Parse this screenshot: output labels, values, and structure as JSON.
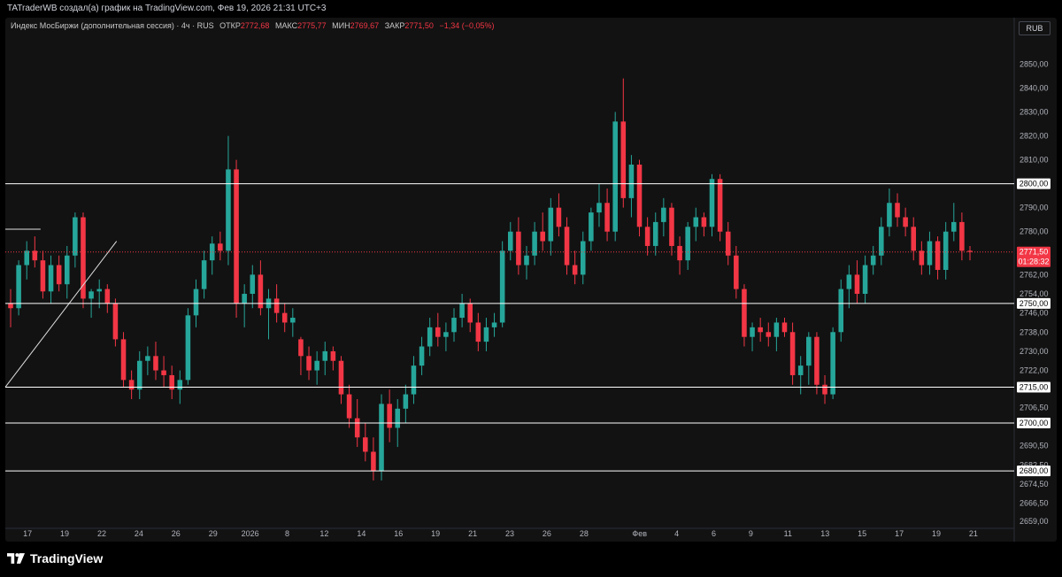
{
  "header": {
    "credit": "TATraderWB создал(а) график на TradingView.com, Фев 19, 2026 21:31 UTC+3"
  },
  "legend": {
    "symbol": "Индекс МосБиржи (дополнительная сессия) · 4ч · RUS",
    "open_label": "ОТКР",
    "open": "2772,68",
    "high_label": "МАКС",
    "high": "2775,77",
    "low_label": "МИН",
    "low": "2769,67",
    "close_label": "ЗАКР",
    "close": "2771,50",
    "change": "−1,34 (−0,05%)"
  },
  "currency_button": "RUB",
  "footer": {
    "brand": "TradingView"
  },
  "colors": {
    "up": "#26a69a",
    "down": "#f23645",
    "level_line": "#ffffff",
    "background": "#121212"
  },
  "chart_data": {
    "type": "candlestick",
    "timeframe": "4ч",
    "ylim": [
      2656,
      2862
    ],
    "y_ticks": [
      "2850,00",
      "2840,00",
      "2830,00",
      "2820,00",
      "2810,00",
      "2800,00",
      "2790,00",
      "2780,00",
      "2770,00",
      "2762,00",
      "2754,00",
      "2746,00",
      "2738,00",
      "2730,00",
      "2722,00",
      "2714,00",
      "2706,50",
      "2698,50",
      "2690,50",
      "2682,50",
      "2674,50",
      "2666,50",
      "2659,00"
    ],
    "y_tick_values": [
      2850,
      2840,
      2830,
      2820,
      2810,
      2800,
      2790,
      2780,
      2770,
      2762,
      2754,
      2746,
      2738,
      2730,
      2722,
      2714,
      2706.5,
      2698.5,
      2690.5,
      2682.5,
      2674.5,
      2666.5,
      2659
    ],
    "hidden_tick_labels": [
      "2770,00",
      "2714,00",
      "2698,50"
    ],
    "x_ticks": [
      {
        "label": "17",
        "x": 0.6
      },
      {
        "label": "19",
        "x": 1.6
      },
      {
        "label": "22",
        "x": 2.6
      },
      {
        "label": "24",
        "x": 3.6
      },
      {
        "label": "26",
        "x": 4.6
      },
      {
        "label": "29",
        "x": 5.6
      },
      {
        "label": "2026",
        "x": 6.6
      },
      {
        "label": "8",
        "x": 7.6
      },
      {
        "label": "12",
        "x": 8.6
      },
      {
        "label": "14",
        "x": 9.6
      },
      {
        "label": "16",
        "x": 10.6
      },
      {
        "label": "19",
        "x": 11.6
      },
      {
        "label": "21",
        "x": 12.6
      },
      {
        "label": "23",
        "x": 13.6
      },
      {
        "label": "26",
        "x": 14.6
      },
      {
        "label": "28",
        "x": 15.6
      },
      {
        "label": "Фев",
        "x": 17.1
      },
      {
        "label": "4",
        "x": 18.1
      },
      {
        "label": "6",
        "x": 19.1
      },
      {
        "label": "9",
        "x": 20.1
      },
      {
        "label": "11",
        "x": 21.1
      },
      {
        "label": "13",
        "x": 22.1
      },
      {
        "label": "15",
        "x": 23.1
      },
      {
        "label": "17",
        "x": 24.1
      },
      {
        "label": "19",
        "x": 25.1
      },
      {
        "label": "21",
        "x": 26.1
      }
    ],
    "x_range": [
      0,
      27.2
    ],
    "levels": [
      {
        "value": 2800.0,
        "label": "2800,00"
      },
      {
        "value": 2750.0,
        "label": "2750,00"
      },
      {
        "value": 2715.0,
        "label": "2715,00"
      },
      {
        "value": 2700.0,
        "label": "2700,00"
      },
      {
        "value": 2680.0,
        "label": "2680,00"
      }
    ],
    "short_level": {
      "value": 2781,
      "x_end": 0.95
    },
    "trendline": {
      "x1": 0,
      "y1": 2715,
      "x2": 3.0,
      "y2": 2776
    },
    "last_price": {
      "value": 2771.5,
      "label": "2771,50",
      "countdown": "01:28:32"
    },
    "candles_ohlc_hint": "approximate reading from the screenshot",
    "candles": [
      [
        2750,
        2756,
        2740,
        2748
      ],
      [
        2748,
        2768,
        2745,
        2766
      ],
      [
        2766,
        2776,
        2760,
        2772
      ],
      [
        2772,
        2778,
        2765,
        2768
      ],
      [
        2768,
        2772,
        2752,
        2755
      ],
      [
        2755,
        2770,
        2750,
        2766
      ],
      [
        2766,
        2770,
        2755,
        2758
      ],
      [
        2758,
        2774,
        2752,
        2770
      ],
      [
        2770,
        2788,
        2765,
        2786
      ],
      [
        2786,
        2788,
        2748,
        2752
      ],
      [
        2752,
        2756,
        2744,
        2755
      ],
      [
        2755,
        2760,
        2748,
        2756
      ],
      [
        2756,
        2758,
        2746,
        2750
      ],
      [
        2750,
        2752,
        2732,
        2735
      ],
      [
        2735,
        2738,
        2715,
        2718
      ],
      [
        2718,
        2722,
        2710,
        2714
      ],
      [
        2714,
        2730,
        2710,
        2726
      ],
      [
        2726,
        2732,
        2720,
        2728
      ],
      [
        2728,
        2734,
        2718,
        2722
      ],
      [
        2722,
        2728,
        2715,
        2720
      ],
      [
        2720,
        2724,
        2710,
        2714
      ],
      [
        2714,
        2722,
        2708,
        2718
      ],
      [
        2718,
        2748,
        2716,
        2745
      ],
      [
        2745,
        2760,
        2740,
        2756
      ],
      [
        2756,
        2772,
        2752,
        2768
      ],
      [
        2768,
        2778,
        2762,
        2775
      ],
      [
        2775,
        2780,
        2768,
        2772
      ],
      [
        2772,
        2820,
        2766,
        2806
      ],
      [
        2806,
        2810,
        2744,
        2750
      ],
      [
        2750,
        2758,
        2740,
        2754
      ],
      [
        2754,
        2766,
        2748,
        2762
      ],
      [
        2762,
        2768,
        2745,
        2748
      ],
      [
        2748,
        2756,
        2735,
        2752
      ],
      [
        2752,
        2758,
        2742,
        2746
      ],
      [
        2746,
        2750,
        2738,
        2742
      ],
      [
        2742,
        2748,
        2736,
        2744
      ],
      [
        2735,
        2736,
        2720,
        2728
      ],
      [
        2728,
        2732,
        2718,
        2722
      ],
      [
        2722,
        2730,
        2716,
        2726
      ],
      [
        2726,
        2734,
        2720,
        2730
      ],
      [
        2730,
        2732,
        2722,
        2726
      ],
      [
        2726,
        2728,
        2708,
        2712
      ],
      [
        2712,
        2716,
        2698,
        2702
      ],
      [
        2702,
        2710,
        2690,
        2694
      ],
      [
        2694,
        2700,
        2684,
        2688
      ],
      [
        2688,
        2694,
        2676,
        2680
      ],
      [
        2680,
        2712,
        2676,
        2708
      ],
      [
        2708,
        2714,
        2692,
        2698
      ],
      [
        2698,
        2710,
        2690,
        2706
      ],
      [
        2706,
        2716,
        2700,
        2712
      ],
      [
        2712,
        2728,
        2708,
        2724
      ],
      [
        2724,
        2736,
        2720,
        2732
      ],
      [
        2732,
        2744,
        2728,
        2740
      ],
      [
        2740,
        2746,
        2732,
        2736
      ],
      [
        2736,
        2742,
        2730,
        2738
      ],
      [
        2738,
        2748,
        2734,
        2744
      ],
      [
        2744,
        2754,
        2740,
        2750
      ],
      [
        2750,
        2752,
        2738,
        2742
      ],
      [
        2742,
        2746,
        2730,
        2734
      ],
      [
        2734,
        2744,
        2730,
        2740
      ],
      [
        2740,
        2746,
        2736,
        2742
      ],
      [
        2742,
        2776,
        2740,
        2772
      ],
      [
        2772,
        2784,
        2768,
        2780
      ],
      [
        2780,
        2786,
        2762,
        2766
      ],
      [
        2766,
        2774,
        2760,
        2770
      ],
      [
        2770,
        2784,
        2766,
        2780
      ],
      [
        2780,
        2788,
        2772,
        2776
      ],
      [
        2776,
        2794,
        2770,
        2790
      ],
      [
        2790,
        2796,
        2778,
        2782
      ],
      [
        2782,
        2786,
        2762,
        2766
      ],
      [
        2766,
        2772,
        2758,
        2762
      ],
      [
        2762,
        2780,
        2758,
        2776
      ],
      [
        2776,
        2790,
        2772,
        2788
      ],
      [
        2788,
        2800,
        2782,
        2792
      ],
      [
        2792,
        2798,
        2776,
        2780
      ],
      [
        2780,
        2830,
        2776,
        2826
      ],
      [
        2826,
        2844,
        2790,
        2794
      ],
      [
        2794,
        2812,
        2786,
        2808
      ],
      [
        2808,
        2810,
        2778,
        2782
      ],
      [
        2782,
        2786,
        2770,
        2774
      ],
      [
        2774,
        2788,
        2770,
        2784
      ],
      [
        2784,
        2794,
        2778,
        2790
      ],
      [
        2790,
        2792,
        2770,
        2774
      ],
      [
        2774,
        2778,
        2762,
        2768
      ],
      [
        2768,
        2784,
        2764,
        2782
      ],
      [
        2782,
        2790,
        2776,
        2786
      ],
      [
        2786,
        2788,
        2778,
        2782
      ],
      [
        2782,
        2804,
        2778,
        2802
      ],
      [
        2802,
        2804,
        2776,
        2780
      ],
      [
        2780,
        2784,
        2766,
        2770
      ],
      [
        2770,
        2774,
        2752,
        2756
      ],
      [
        2756,
        2758,
        2732,
        2736
      ],
      [
        2736,
        2742,
        2730,
        2740
      ],
      [
        2740,
        2744,
        2734,
        2738
      ],
      [
        2738,
        2742,
        2732,
        2736
      ],
      [
        2736,
        2744,
        2730,
        2742
      ],
      [
        2742,
        2744,
        2736,
        2738
      ],
      [
        2738,
        2742,
        2716,
        2720
      ],
      [
        2720,
        2728,
        2712,
        2724
      ],
      [
        2724,
        2738,
        2716,
        2736
      ],
      [
        2736,
        2738,
        2712,
        2716
      ],
      [
        2716,
        2720,
        2708,
        2712
      ],
      [
        2712,
        2740,
        2710,
        2738
      ],
      [
        2738,
        2760,
        2734,
        2756
      ],
      [
        2756,
        2766,
        2748,
        2762
      ],
      [
        2762,
        2768,
        2750,
        2754
      ],
      [
        2754,
        2770,
        2750,
        2766
      ],
      [
        2766,
        2774,
        2762,
        2770
      ],
      [
        2770,
        2786,
        2766,
        2782
      ],
      [
        2782,
        2798,
        2778,
        2792
      ],
      [
        2792,
        2796,
        2782,
        2786
      ],
      [
        2786,
        2790,
        2778,
        2782
      ],
      [
        2782,
        2786,
        2768,
        2772
      ],
      [
        2772,
        2776,
        2762,
        2766
      ],
      [
        2766,
        2780,
        2762,
        2776
      ],
      [
        2776,
        2778,
        2760,
        2764
      ],
      [
        2764,
        2784,
        2760,
        2780
      ],
      [
        2780,
        2792,
        2776,
        2784
      ],
      [
        2784,
        2788,
        2768,
        2772
      ],
      [
        2772,
        2774,
        2768,
        2771.5
      ]
    ]
  }
}
